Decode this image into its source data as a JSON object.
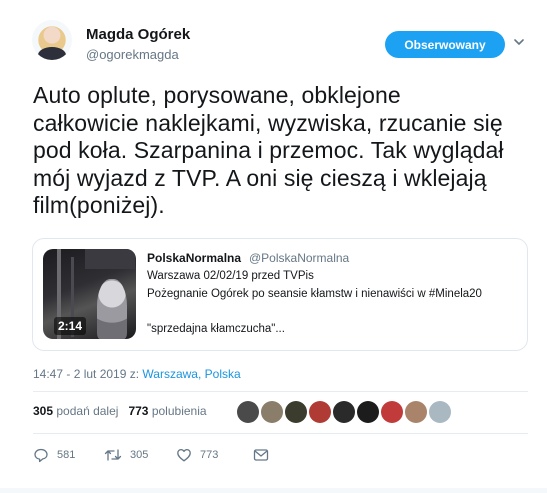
{
  "author": {
    "display_name": "Magda Ogórek",
    "handle": "@ogorekmagda",
    "follow_label": "Obserwowany"
  },
  "tweet": {
    "text_lines": [
      "Auto oplute, porysowane, obklejone",
      "całkowicie naklejkami, wyzwiska, rzucanie się",
      "pod koła. Szarpanina i przemoc. Tak wyglądał",
      "mój wyjazd z TVP. A oni się cieszą i wklejają",
      "film(poniżej)."
    ],
    "time_prefix": "14:47 - 2 lut 2019 z: ",
    "location": "Warszawa, Polska"
  },
  "quoted": {
    "display_name": "PolskaNormalna",
    "handle": "@PolskaNormalna",
    "lines": [
      "Warszawa  02/02/19 przed TVPis",
      "Pożegnanie Ogórek po seansie kłamstw i nienawiści w #Minela20",
      "\"sprzedajna kłamczucha\"..."
    ],
    "video_duration": "2:14"
  },
  "stats": {
    "retweets_count": "305",
    "retweets_label": "podań dalej",
    "likes_count": "773",
    "likes_label": "polubienia"
  },
  "actions": {
    "reply_count": "581",
    "retweet_count": "305",
    "like_count": "773"
  },
  "liker_avatars": [
    {
      "icon": "avatar-1",
      "color": "#4a4a4a"
    },
    {
      "icon": "avatar-2",
      "color": "#8a7d6a"
    },
    {
      "icon": "avatar-3",
      "color": "#3b3b2e"
    },
    {
      "icon": "avatar-4",
      "color": "#b03a34"
    },
    {
      "icon": "avatar-5",
      "color": "#2a2a2a"
    },
    {
      "icon": "avatar-6",
      "color": "#1c1c1c"
    },
    {
      "icon": "avatar-7",
      "color": "#c23b3b"
    },
    {
      "icon": "avatar-8",
      "color": "#a9836a"
    },
    {
      "icon": "avatar-9",
      "color": "#aab8c2"
    }
  ],
  "colors": {
    "accent": "#1da1f2",
    "link": "#1b95e0",
    "muted": "#657786"
  }
}
